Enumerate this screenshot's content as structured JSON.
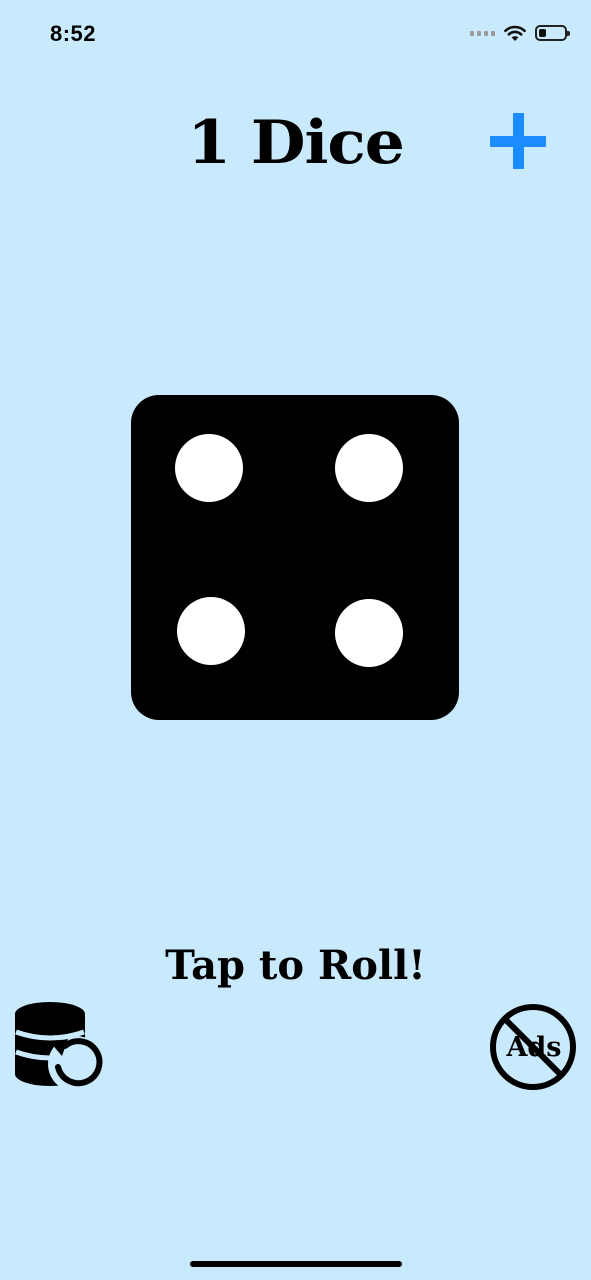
{
  "status": {
    "time": "8:52",
    "battery_level": 0.3
  },
  "header": {
    "title": "1 Dice",
    "add_icon": "plus-icon"
  },
  "die": {
    "value": 4
  },
  "main": {
    "tap_label": "Tap to Roll!"
  },
  "footer": {
    "history_icon": "history-restore-icon",
    "no_ads_label": "Ads",
    "no_ads_icon": "no-ads-icon"
  },
  "colors": {
    "background": "#c9e9fc",
    "accent": "#1a8cff",
    "die": "#000000",
    "pip": "#ffffff"
  }
}
